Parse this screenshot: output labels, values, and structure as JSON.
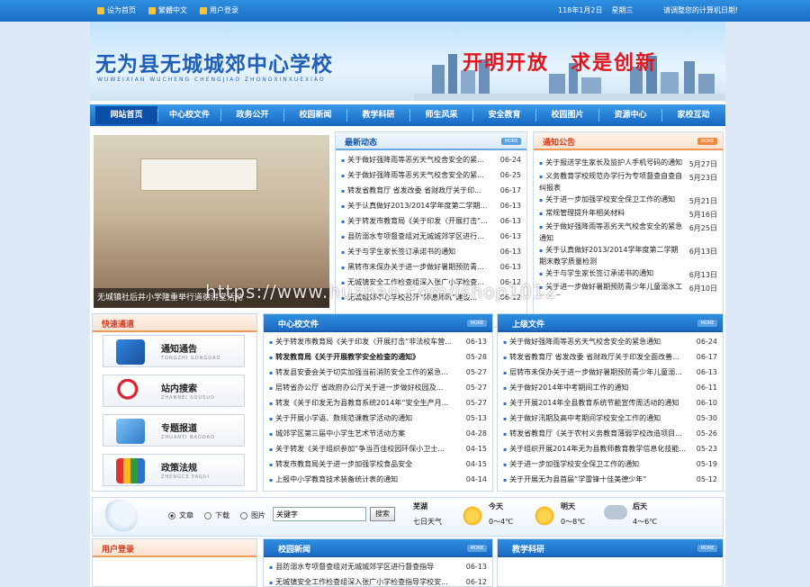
{
  "topbar": {
    "links": [
      {
        "label": "设为首页",
        "icon": "home-icon"
      },
      {
        "label": "繁體中文",
        "icon": "language-icon"
      },
      {
        "label": "用户登录",
        "icon": "user-icon"
      }
    ],
    "date": "118年1月2日",
    "weekday": "星期三",
    "right_text": "请调整您的计算机日期!"
  },
  "banner": {
    "title": "无为县无城城郊中心学校",
    "pinyin": "WUWEIXIAN WUCHENG CHENGJIAO ZHONGXINXUEXIAO",
    "slogan": "开明开放　求是创新"
  },
  "nav": [
    "网站首页",
    "中心校文件",
    "政务公开",
    "校园新闻",
    "教学科研",
    "师生风采",
    "安全教育",
    "校园图片",
    "资源中心",
    "家校互动"
  ],
  "photo": {
    "caption": "无城镇社后井小学隆重举行道德讲堂活动"
  },
  "watermark": "https://www.huzhan.com/ishop1012",
  "news": {
    "title": "最新动态",
    "more": "MORE",
    "items": [
      {
        "text": "关于做好强降雨等恶劣天气校舍安全的紧...",
        "date": "06-24"
      },
      {
        "text": "关于做好强降雨等恶劣天气校舍安全的紧...",
        "date": "06-25"
      },
      {
        "text": "转发省教育厅 省发改委 省财政厅关于印...",
        "date": "06-17"
      },
      {
        "text": "关于认真做好2013/2014学年度第二学期期...",
        "date": "06-13"
      },
      {
        "text": "关于转发市教育局《关于印发〈开展打击“...",
        "date": "06-13"
      },
      {
        "text": "县防溺水专项督查组对无城城郊学区进行...",
        "date": "06-13"
      },
      {
        "text": "关于与学生家长签订承诺书的通知",
        "date": "06-13"
      },
      {
        "text": "黑转市未保办关于进一步做好暑期预防青...",
        "date": "06-13"
      },
      {
        "text": "无城镇安全工作检查组深入张广小学检查...",
        "date": "06-12"
      },
      {
        "text": "无城城郊中心学校召开“师德师风”建设...",
        "date": "06-12"
      }
    ]
  },
  "notice": {
    "title": "通知公告",
    "more": "MORE",
    "items": [
      {
        "text": "关于报送学生家长及监护人手机号码的通知",
        "date": "5月27日"
      },
      {
        "text": "义务教育学校规范办学行为专项督查自查自纠报表",
        "date": "5月23日"
      },
      {
        "text": "关于进一步加强学校安全保卫工作的通知",
        "date": "5月21日"
      },
      {
        "text": "常规管理提升年相关材料",
        "date": "5月16日"
      },
      {
        "text": "关于做好强降雨等恶劣天气校舍安全的紧急通知",
        "date": "6月25日"
      },
      {
        "text": "关于认真做好2013/2014学年度第二学期期末教学质量检测",
        "date": "6月13日"
      },
      {
        "text": "关于与学生家长签订承诺书的通知",
        "date": "6月13日"
      },
      {
        "text": "关于进一步做好暑期预防青少年儿童溺水工作专项",
        "date": "6月10日"
      }
    ]
  },
  "quick": {
    "title": "快速通道",
    "buttons": [
      {
        "label": "通知通告",
        "sub": "TONGZHI GONGGAO",
        "icon": "book-icon"
      },
      {
        "label": "站内搜索",
        "sub": "ZHANNEI SOUSUO",
        "icon": "magnifier-icon"
      },
      {
        "label": "专题报道",
        "sub": "ZHUANTI BAODAO",
        "icon": "folder-icon"
      },
      {
        "label": "政策法规",
        "sub": "ZHENGCE FAGUI",
        "icon": "books-icon"
      }
    ]
  },
  "center_files": {
    "title": "中心校文件",
    "more": "MORE",
    "items": [
      {
        "text": "关于转发市教育局《关于印发〈开展打击“非法校车营...",
        "date": "06-13",
        "hl": false
      },
      {
        "text": "转发教育局《关于开展教学安全检查的通知》",
        "date": "05-28",
        "hl": true
      },
      {
        "text": "转发县安委会关于切实加强当前消防安全工作的紧急...",
        "date": "05-27",
        "hl": false
      },
      {
        "text": "层转省办公厅 省政府办公厅关于进一步做好校园及...",
        "date": "05-27",
        "hl": false
      },
      {
        "text": "转发《关于印发无为县教育系统2014年“安全生产月...",
        "date": "05-27",
        "hl": false
      },
      {
        "text": "关于开展小学语、数规范课教学活动的通知",
        "date": "05-13",
        "hl": false
      },
      {
        "text": "城郊学区第三届中小学生艺术节活动方案",
        "date": "04-28",
        "hl": false
      },
      {
        "text": "关于转发《关于组织参加“争当百佳校园环保小卫士...",
        "date": "04-15",
        "hl": false
      },
      {
        "text": "转发市教育局关于进一步加强学校食品安全",
        "date": "04-15",
        "hl": false
      },
      {
        "text": "上报中小学教育技术装备统计表的通知",
        "date": "04-14",
        "hl": false
      }
    ]
  },
  "upper_files": {
    "title": "上级文件",
    "more": "MORE",
    "items": [
      {
        "text": "关于做好强降雨等恶劣天气校舍安全的紧急通知",
        "date": "06-24"
      },
      {
        "text": "转发省教育厅 省发改委 省财政厅关于印发全面改善...",
        "date": "06-17"
      },
      {
        "text": "层转市未保办关于进一步做好暑期预防青少年儿童溺...",
        "date": "06-13"
      },
      {
        "text": "关于做好2014年中考期间工作的通知",
        "date": "06-11"
      },
      {
        "text": "关于开展2014年全县教育系统节能宣传周活动的通知",
        "date": "06-10"
      },
      {
        "text": "关于做好汛期及高中考期间学校安全工作的通知",
        "date": "05-30"
      },
      {
        "text": "转发省教育厅《关于农村义务教育薄弱学校改造项目...",
        "date": "05-26"
      },
      {
        "text": "关于组织开展2014年无为县教师教育教学信息化技能...",
        "date": "05-23"
      },
      {
        "text": "关于进一步加强学校安全保卫工作的通知",
        "date": "05-19"
      },
      {
        "text": "关于开展无为县首届“学雷锋十佳美德少年”",
        "date": "05-12"
      }
    ]
  },
  "search": {
    "options": [
      "文章",
      "下载",
      "图片"
    ],
    "selected": "文章",
    "value": "关键字",
    "button": "搜索"
  },
  "weather": {
    "city": "芜湖",
    "period": "七日天气",
    "days": [
      {
        "day": "今天",
        "temp": "0～4℃",
        "icon": "sunny-icon"
      },
      {
        "day": "明天",
        "temp": "0～8℃",
        "icon": "sunny-icon"
      },
      {
        "day": "后天",
        "temp": "4～6℃",
        "icon": "rain-icon"
      }
    ]
  },
  "bottom": {
    "login_title": "用户登录",
    "campus_title": "校园新闻",
    "campus_more": "MORE",
    "campus_items": [
      {
        "text": "县防溺水专项督查组对无城城郊学区进行督查指导",
        "date": "06-13"
      },
      {
        "text": "无城镇安全工作检查组深入张广小学检查指导学校安...",
        "date": "06-12"
      }
    ],
    "research_title": "教学科研",
    "research_more": "MORE"
  }
}
